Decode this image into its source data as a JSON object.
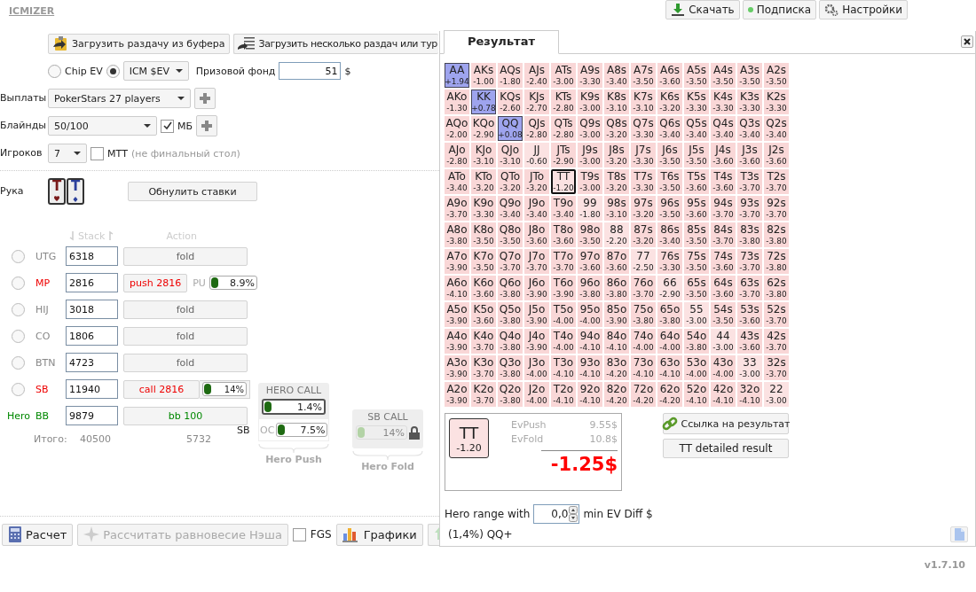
{
  "app": {
    "logo": "ICMIZER",
    "version": "v1.7.10"
  },
  "top_buttons": [
    {
      "label": "Скачать",
      "kind": "download"
    },
    {
      "label": "Подписка",
      "kind": "dot"
    },
    {
      "label": "Настройки",
      "kind": "gears"
    }
  ],
  "load_buttons": [
    {
      "label": "Загрузить раздачу из буфера",
      "kind": "clipboard"
    },
    {
      "label": "Загрузить несколько раздач или тур",
      "kind": "list"
    }
  ],
  "ev_modes": [
    {
      "label": "Chip EV",
      "kind": "text",
      "selected": false
    },
    {
      "label": "ICM $EV",
      "kind": "select",
      "selected": true
    }
  ],
  "prize_pool": {
    "label": "Призовой фонд",
    "value": "51",
    "unit": "$"
  },
  "payouts": {
    "label": "Выплаты",
    "value": "PokerStars 27 players"
  },
  "blinds": {
    "label": "Блайнды",
    "value": "50/100",
    "ante_label": "МБ",
    "ante_checked": true
  },
  "players": {
    "label": "Игроков",
    "value": "7",
    "mtt_label": "МТТ",
    "mtt_checked": false,
    "mtt_note": "(не финальный стол)"
  },
  "hand": {
    "label": "Рука",
    "cards": [
      {
        "rank": "T",
        "kind": "hearts"
      },
      {
        "rank": "T",
        "kind": "diamonds"
      }
    ],
    "reset_button": "Обнулить ставки"
  },
  "table": {
    "stack_header": "Stack",
    "action_header": "Action",
    "seats": [
      {
        "position": "UTG",
        "stack": "6318",
        "action": "fold",
        "kind": "fold",
        "selected": false
      },
      {
        "position": "MP",
        "stack": "2816",
        "action": "push 2816",
        "kind": "push",
        "selected": false,
        "range": {
          "label": "PU",
          "level": 0.089,
          "reading": "8.9%"
        }
      },
      {
        "position": "HIJ",
        "stack": "3018",
        "action": "fold",
        "kind": "fold",
        "selected": false
      },
      {
        "position": "CO",
        "stack": "1806",
        "action": "fold",
        "kind": "fold",
        "selected": false
      },
      {
        "position": "BTN",
        "stack": "4723",
        "action": "fold",
        "kind": "fold",
        "selected": false
      },
      {
        "position": "SB",
        "stack": "11940",
        "action": "call 2816",
        "kind": "call",
        "selected": false,
        "range": {
          "level": 0.14,
          "reading": "14%"
        }
      },
      {
        "position": "BB",
        "hero_label": "Hero",
        "stack": "9879",
        "action": "bb 100",
        "kind": "hero"
      }
    ],
    "totals": {
      "label": "Итого:",
      "stack": "40500",
      "pot": "5732"
    }
  },
  "hero_call": {
    "title": "HERO CALL",
    "level": 0.014,
    "reading": "1.4%",
    "sb_label": "SB",
    "oc": {
      "label": "OC",
      "level": 0.075,
      "reading": "7.5%"
    },
    "caption": "Hero Push"
  },
  "sb_call": {
    "title": "SB CALL",
    "level": 0.14,
    "reading": "14%",
    "disabled": true,
    "locked": true,
    "caption": "Hero Fold"
  },
  "bottom": {
    "buttons": [
      {
        "label": "Расчет",
        "kind": "calc",
        "disabled": false
      },
      {
        "label": "Рассчитать равновесие Нэша",
        "kind": "nash",
        "disabled": true
      }
    ],
    "fgs": {
      "label": "FGS",
      "checked": false
    },
    "charts_button": "Графики"
  },
  "result": {
    "tab": "Результат",
    "grid": [
      [
        {
          "hand": "AA",
          "ev": "+1.94",
          "in_range": true,
          "selected": false
        },
        {
          "hand": "AKs",
          "ev": "-1.00",
          "in_range": false,
          "selected": false
        },
        {
          "hand": "AQs",
          "ev": "-1.80",
          "in_range": false,
          "selected": false
        },
        {
          "hand": "AJs",
          "ev": "-2.40",
          "in_range": false,
          "selected": false
        },
        {
          "hand": "ATs",
          "ev": "-3.00",
          "in_range": false,
          "selected": false
        },
        {
          "hand": "A9s",
          "ev": "-3.30",
          "in_range": false,
          "selected": false
        },
        {
          "hand": "A8s",
          "ev": "-3.40",
          "in_range": false,
          "selected": false
        },
        {
          "hand": "A7s",
          "ev": "-3.50",
          "in_range": false,
          "selected": false
        },
        {
          "hand": "A6s",
          "ev": "-3.60",
          "in_range": false,
          "selected": false
        },
        {
          "hand": "A5s",
          "ev": "-3.50",
          "in_range": false,
          "selected": false
        },
        {
          "hand": "A4s",
          "ev": "-3.50",
          "in_range": false,
          "selected": false
        },
        {
          "hand": "A3s",
          "ev": "-3.50",
          "in_range": false,
          "selected": false
        },
        {
          "hand": "A2s",
          "ev": "-3.50",
          "in_range": false,
          "selected": false
        }
      ],
      [
        {
          "hand": "AKo",
          "ev": "-1.30",
          "in_range": false,
          "selected": false
        },
        {
          "hand": "KK",
          "ev": "+0.78",
          "in_range": true,
          "selected": false
        },
        {
          "hand": "KQs",
          "ev": "-2.60",
          "in_range": false,
          "selected": false
        },
        {
          "hand": "KJs",
          "ev": "-2.70",
          "in_range": false,
          "selected": false
        },
        {
          "hand": "KTs",
          "ev": "-2.80",
          "in_range": false,
          "selected": false
        },
        {
          "hand": "K9s",
          "ev": "-3.00",
          "in_range": false,
          "selected": false
        },
        {
          "hand": "K8s",
          "ev": "-3.10",
          "in_range": false,
          "selected": false
        },
        {
          "hand": "K7s",
          "ev": "-3.10",
          "in_range": false,
          "selected": false
        },
        {
          "hand": "K6s",
          "ev": "-3.20",
          "in_range": false,
          "selected": false
        },
        {
          "hand": "K5s",
          "ev": "-3.30",
          "in_range": false,
          "selected": false
        },
        {
          "hand": "K4s",
          "ev": "-3.30",
          "in_range": false,
          "selected": false
        },
        {
          "hand": "K3s",
          "ev": "-3.30",
          "in_range": false,
          "selected": false
        },
        {
          "hand": "K2s",
          "ev": "-3.30",
          "in_range": false,
          "selected": false
        }
      ],
      [
        {
          "hand": "AQo",
          "ev": "-2.00",
          "in_range": false,
          "selected": false
        },
        {
          "hand": "KQo",
          "ev": "-2.90",
          "in_range": false,
          "selected": false
        },
        {
          "hand": "QQ",
          "ev": "+0.08",
          "in_range": true,
          "selected": false
        },
        {
          "hand": "QJs",
          "ev": "-2.80",
          "in_range": false,
          "selected": false
        },
        {
          "hand": "QTs",
          "ev": "-2.80",
          "in_range": false,
          "selected": false
        },
        {
          "hand": "Q9s",
          "ev": "-3.00",
          "in_range": false,
          "selected": false
        },
        {
          "hand": "Q8s",
          "ev": "-3.20",
          "in_range": false,
          "selected": false
        },
        {
          "hand": "Q7s",
          "ev": "-3.30",
          "in_range": false,
          "selected": false
        },
        {
          "hand": "Q6s",
          "ev": "-3.40",
          "in_range": false,
          "selected": false
        },
        {
          "hand": "Q5s",
          "ev": "-3.40",
          "in_range": false,
          "selected": false
        },
        {
          "hand": "Q4s",
          "ev": "-3.40",
          "in_range": false,
          "selected": false
        },
        {
          "hand": "Q3s",
          "ev": "-3.40",
          "in_range": false,
          "selected": false
        },
        {
          "hand": "Q2s",
          "ev": "-3.40",
          "in_range": false,
          "selected": false
        }
      ],
      [
        {
          "hand": "AJo",
          "ev": "-2.80",
          "in_range": false,
          "selected": false
        },
        {
          "hand": "KJo",
          "ev": "-3.10",
          "in_range": false,
          "selected": false
        },
        {
          "hand": "QJo",
          "ev": "-3.10",
          "in_range": false,
          "selected": false
        },
        {
          "hand": "JJ",
          "ev": "-0.60",
          "in_range": false,
          "selected": false
        },
        {
          "hand": "JTs",
          "ev": "-2.90",
          "in_range": false,
          "selected": false
        },
        {
          "hand": "J9s",
          "ev": "-3.00",
          "in_range": false,
          "selected": false
        },
        {
          "hand": "J8s",
          "ev": "-3.20",
          "in_range": false,
          "selected": false
        },
        {
          "hand": "J7s",
          "ev": "-3.30",
          "in_range": false,
          "selected": false
        },
        {
          "hand": "J6s",
          "ev": "-3.50",
          "in_range": false,
          "selected": false
        },
        {
          "hand": "J5s",
          "ev": "-3.50",
          "in_range": false,
          "selected": false
        },
        {
          "hand": "J4s",
          "ev": "-3.60",
          "in_range": false,
          "selected": false
        },
        {
          "hand": "J3s",
          "ev": "-3.60",
          "in_range": false,
          "selected": false
        },
        {
          "hand": "J2s",
          "ev": "-3.60",
          "in_range": false,
          "selected": false
        }
      ],
      [
        {
          "hand": "ATo",
          "ev": "-3.40",
          "in_range": false,
          "selected": false
        },
        {
          "hand": "KTo",
          "ev": "-3.20",
          "in_range": false,
          "selected": false
        },
        {
          "hand": "QTo",
          "ev": "-3.20",
          "in_range": false,
          "selected": false
        },
        {
          "hand": "JTo",
          "ev": "-3.20",
          "in_range": false,
          "selected": false
        },
        {
          "hand": "TT",
          "ev": "-1.20",
          "in_range": false,
          "selected": true
        },
        {
          "hand": "T9s",
          "ev": "-3.00",
          "in_range": false,
          "selected": false
        },
        {
          "hand": "T8s",
          "ev": "-3.20",
          "in_range": false,
          "selected": false
        },
        {
          "hand": "T7s",
          "ev": "-3.30",
          "in_range": false,
          "selected": false
        },
        {
          "hand": "T6s",
          "ev": "-3.50",
          "in_range": false,
          "selected": false
        },
        {
          "hand": "T5s",
          "ev": "-3.60",
          "in_range": false,
          "selected": false
        },
        {
          "hand": "T4s",
          "ev": "-3.60",
          "in_range": false,
          "selected": false
        },
        {
          "hand": "T3s",
          "ev": "-3.70",
          "in_range": false,
          "selected": false
        },
        {
          "hand": "T2s",
          "ev": "-3.70",
          "in_range": false,
          "selected": false
        }
      ],
      [
        {
          "hand": "A9o",
          "ev": "-3.70",
          "in_range": false,
          "selected": false
        },
        {
          "hand": "K9o",
          "ev": "-3.30",
          "in_range": false,
          "selected": false
        },
        {
          "hand": "Q9o",
          "ev": "-3.40",
          "in_range": false,
          "selected": false
        },
        {
          "hand": "J9o",
          "ev": "-3.40",
          "in_range": false,
          "selected": false
        },
        {
          "hand": "T9o",
          "ev": "-3.40",
          "in_range": false,
          "selected": false
        },
        {
          "hand": "99",
          "ev": "-1.80",
          "in_range": false,
          "selected": false
        },
        {
          "hand": "98s",
          "ev": "-3.10",
          "in_range": false,
          "selected": false
        },
        {
          "hand": "97s",
          "ev": "-3.20",
          "in_range": false,
          "selected": false
        },
        {
          "hand": "96s",
          "ev": "-3.50",
          "in_range": false,
          "selected": false
        },
        {
          "hand": "95s",
          "ev": "-3.60",
          "in_range": false,
          "selected": false
        },
        {
          "hand": "94s",
          "ev": "-3.70",
          "in_range": false,
          "selected": false
        },
        {
          "hand": "93s",
          "ev": "-3.70",
          "in_range": false,
          "selected": false
        },
        {
          "hand": "92s",
          "ev": "-3.70",
          "in_range": false,
          "selected": false
        }
      ],
      [
        {
          "hand": "A8o",
          "ev": "-3.80",
          "in_range": false,
          "selected": false
        },
        {
          "hand": "K8o",
          "ev": "-3.50",
          "in_range": false,
          "selected": false
        },
        {
          "hand": "Q8o",
          "ev": "-3.50",
          "in_range": false,
          "selected": false
        },
        {
          "hand": "J8o",
          "ev": "-3.60",
          "in_range": false,
          "selected": false
        },
        {
          "hand": "T8o",
          "ev": "-3.60",
          "in_range": false,
          "selected": false
        },
        {
          "hand": "98o",
          "ev": "-3.50",
          "in_range": false,
          "selected": false
        },
        {
          "hand": "88",
          "ev": "-2.20",
          "in_range": false,
          "selected": false
        },
        {
          "hand": "87s",
          "ev": "-3.20",
          "in_range": false,
          "selected": false
        },
        {
          "hand": "86s",
          "ev": "-3.40",
          "in_range": false,
          "selected": false
        },
        {
          "hand": "85s",
          "ev": "-3.50",
          "in_range": false,
          "selected": false
        },
        {
          "hand": "84s",
          "ev": "-3.70",
          "in_range": false,
          "selected": false
        },
        {
          "hand": "83s",
          "ev": "-3.80",
          "in_range": false,
          "selected": false
        },
        {
          "hand": "82s",
          "ev": "-3.80",
          "in_range": false,
          "selected": false
        }
      ],
      [
        {
          "hand": "A7o",
          "ev": "-3.90",
          "in_range": false,
          "selected": false
        },
        {
          "hand": "K7o",
          "ev": "-3.50",
          "in_range": false,
          "selected": false
        },
        {
          "hand": "Q7o",
          "ev": "-3.70",
          "in_range": false,
          "selected": false
        },
        {
          "hand": "J7o",
          "ev": "-3.70",
          "in_range": false,
          "selected": false
        },
        {
          "hand": "T7o",
          "ev": "-3.70",
          "in_range": false,
          "selected": false
        },
        {
          "hand": "97o",
          "ev": "-3.60",
          "in_range": false,
          "selected": false
        },
        {
          "hand": "87o",
          "ev": "-3.60",
          "in_range": false,
          "selected": false
        },
        {
          "hand": "77",
          "ev": "-2.50",
          "in_range": false,
          "selected": false
        },
        {
          "hand": "76s",
          "ev": "-3.30",
          "in_range": false,
          "selected": false
        },
        {
          "hand": "75s",
          "ev": "-3.50",
          "in_range": false,
          "selected": false
        },
        {
          "hand": "74s",
          "ev": "-3.60",
          "in_range": false,
          "selected": false
        },
        {
          "hand": "73s",
          "ev": "-3.70",
          "in_range": false,
          "selected": false
        },
        {
          "hand": "72s",
          "ev": "-3.80",
          "in_range": false,
          "selected": false
        }
      ],
      [
        {
          "hand": "A6o",
          "ev": "-4.10",
          "in_range": false,
          "selected": false
        },
        {
          "hand": "K6o",
          "ev": "-3.60",
          "in_range": false,
          "selected": false
        },
        {
          "hand": "Q6o",
          "ev": "-3.80",
          "in_range": false,
          "selected": false
        },
        {
          "hand": "J6o",
          "ev": "-3.90",
          "in_range": false,
          "selected": false
        },
        {
          "hand": "T6o",
          "ev": "-3.90",
          "in_range": false,
          "selected": false
        },
        {
          "hand": "96o",
          "ev": "-3.80",
          "in_range": false,
          "selected": false
        },
        {
          "hand": "86o",
          "ev": "-3.80",
          "in_range": false,
          "selected": false
        },
        {
          "hand": "76o",
          "ev": "-3.70",
          "in_range": false,
          "selected": false
        },
        {
          "hand": "66",
          "ev": "-2.90",
          "in_range": false,
          "selected": false
        },
        {
          "hand": "65s",
          "ev": "-3.50",
          "in_range": false,
          "selected": false
        },
        {
          "hand": "64s",
          "ev": "-3.60",
          "in_range": false,
          "selected": false
        },
        {
          "hand": "63s",
          "ev": "-3.70",
          "in_range": false,
          "selected": false
        },
        {
          "hand": "62s",
          "ev": "-3.80",
          "in_range": false,
          "selected": false
        }
      ],
      [
        {
          "hand": "A5o",
          "ev": "-3.90",
          "in_range": false,
          "selected": false
        },
        {
          "hand": "K5o",
          "ev": "-3.60",
          "in_range": false,
          "selected": false
        },
        {
          "hand": "Q5o",
          "ev": "-3.80",
          "in_range": false,
          "selected": false
        },
        {
          "hand": "J5o",
          "ev": "-3.90",
          "in_range": false,
          "selected": false
        },
        {
          "hand": "T5o",
          "ev": "-4.00",
          "in_range": false,
          "selected": false
        },
        {
          "hand": "95o",
          "ev": "-4.00",
          "in_range": false,
          "selected": false
        },
        {
          "hand": "85o",
          "ev": "-3.90",
          "in_range": false,
          "selected": false
        },
        {
          "hand": "75o",
          "ev": "-3.80",
          "in_range": false,
          "selected": false
        },
        {
          "hand": "65o",
          "ev": "-3.80",
          "in_range": false,
          "selected": false
        },
        {
          "hand": "55",
          "ev": "-3.00",
          "in_range": false,
          "selected": false
        },
        {
          "hand": "54s",
          "ev": "-3.50",
          "in_range": false,
          "selected": false
        },
        {
          "hand": "53s",
          "ev": "-3.60",
          "in_range": false,
          "selected": false
        },
        {
          "hand": "52s",
          "ev": "-3.70",
          "in_range": false,
          "selected": false
        }
      ],
      [
        {
          "hand": "A4o",
          "ev": "-3.90",
          "in_range": false,
          "selected": false
        },
        {
          "hand": "K4o",
          "ev": "-3.70",
          "in_range": false,
          "selected": false
        },
        {
          "hand": "Q4o",
          "ev": "-3.80",
          "in_range": false,
          "selected": false
        },
        {
          "hand": "J4o",
          "ev": "-3.90",
          "in_range": false,
          "selected": false
        },
        {
          "hand": "T4o",
          "ev": "-4.00",
          "in_range": false,
          "selected": false
        },
        {
          "hand": "94o",
          "ev": "-4.10",
          "in_range": false,
          "selected": false
        },
        {
          "hand": "84o",
          "ev": "-4.10",
          "in_range": false,
          "selected": false
        },
        {
          "hand": "74o",
          "ev": "-4.00",
          "in_range": false,
          "selected": false
        },
        {
          "hand": "64o",
          "ev": "-4.00",
          "in_range": false,
          "selected": false
        },
        {
          "hand": "54o",
          "ev": "-3.80",
          "in_range": false,
          "selected": false
        },
        {
          "hand": "44",
          "ev": "-3.00",
          "in_range": false,
          "selected": false
        },
        {
          "hand": "43s",
          "ev": "-3.60",
          "in_range": false,
          "selected": false
        },
        {
          "hand": "42s",
          "ev": "-3.70",
          "in_range": false,
          "selected": false
        }
      ],
      [
        {
          "hand": "A3o",
          "ev": "-3.90",
          "in_range": false,
          "selected": false
        },
        {
          "hand": "K3o",
          "ev": "-3.70",
          "in_range": false,
          "selected": false
        },
        {
          "hand": "Q3o",
          "ev": "-3.80",
          "in_range": false,
          "selected": false
        },
        {
          "hand": "J3o",
          "ev": "-4.00",
          "in_range": false,
          "selected": false
        },
        {
          "hand": "T3o",
          "ev": "-4.10",
          "in_range": false,
          "selected": false
        },
        {
          "hand": "93o",
          "ev": "-4.10",
          "in_range": false,
          "selected": false
        },
        {
          "hand": "83o",
          "ev": "-4.20",
          "in_range": false,
          "selected": false
        },
        {
          "hand": "73o",
          "ev": "-4.10",
          "in_range": false,
          "selected": false
        },
        {
          "hand": "63o",
          "ev": "-4.10",
          "in_range": false,
          "selected": false
        },
        {
          "hand": "53o",
          "ev": "-4.00",
          "in_range": false,
          "selected": false
        },
        {
          "hand": "43o",
          "ev": "-4.00",
          "in_range": false,
          "selected": false
        },
        {
          "hand": "33",
          "ev": "-3.00",
          "in_range": false,
          "selected": false
        },
        {
          "hand": "32s",
          "ev": "-3.70",
          "in_range": false,
          "selected": false
        }
      ],
      [
        {
          "hand": "A2o",
          "ev": "-3.90",
          "in_range": false,
          "selected": false
        },
        {
          "hand": "K2o",
          "ev": "-3.70",
          "in_range": false,
          "selected": false
        },
        {
          "hand": "Q2o",
          "ev": "-3.80",
          "in_range": false,
          "selected": false
        },
        {
          "hand": "J2o",
          "ev": "-4.00",
          "in_range": false,
          "selected": false
        },
        {
          "hand": "T2o",
          "ev": "-4.10",
          "in_range": false,
          "selected": false
        },
        {
          "hand": "92o",
          "ev": "-4.10",
          "in_range": false,
          "selected": false
        },
        {
          "hand": "82o",
          "ev": "-4.20",
          "in_range": false,
          "selected": false
        },
        {
          "hand": "72o",
          "ev": "-4.20",
          "in_range": false,
          "selected": false
        },
        {
          "hand": "62o",
          "ev": "-4.20",
          "in_range": false,
          "selected": false
        },
        {
          "hand": "52o",
          "ev": "-4.10",
          "in_range": false,
          "selected": false
        },
        {
          "hand": "42o",
          "ev": "-4.10",
          "in_range": false,
          "selected": false
        },
        {
          "hand": "32o",
          "ev": "-4.10",
          "in_range": false,
          "selected": false
        },
        {
          "hand": "22",
          "ev": "-3.00",
          "in_range": false,
          "selected": false
        }
      ]
    ],
    "summary": {
      "hand": "TT",
      "ev": "-1.20",
      "ev_push_label": "EvPush",
      "ev_push": "9.55$",
      "ev_fold_label": "EvFold",
      "ev_fold": "10.8$",
      "diff": "-1.25$"
    },
    "link_button": "Ссылка на результат",
    "detail_button": "TT detailed result",
    "range_filter": {
      "label": "Hero range with",
      "value": "0,0",
      "unit_label": "min EV Diff $"
    },
    "range_text": "(1,4%) QQ+"
  }
}
